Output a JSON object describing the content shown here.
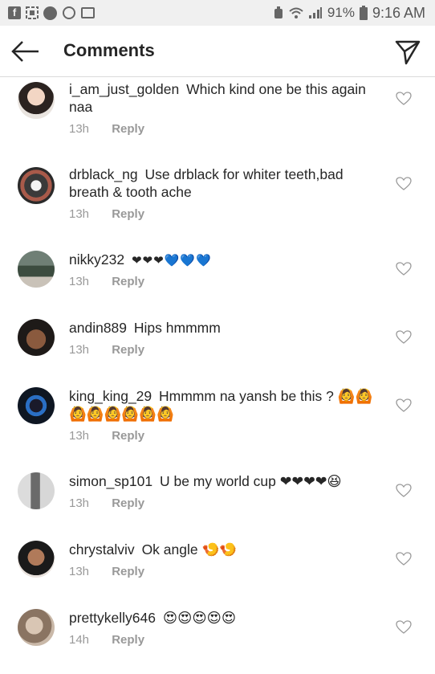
{
  "status_bar": {
    "battery": "91%",
    "time": "9:16 AM"
  },
  "header": {
    "title": "Comments"
  },
  "comments": [
    {
      "username": "i_am_just_golden",
      "text": "Which kind one be this again naa",
      "time": "13h",
      "reply": "Reply"
    },
    {
      "username": "drblack_ng",
      "text": "Use drblack for whiter teeth,bad breath & tooth ache",
      "time": "13h",
      "reply": "Reply"
    },
    {
      "username": "nikky232",
      "text": "❤❤❤💙💙💙",
      "time": "13h",
      "reply": "Reply"
    },
    {
      "username": "andin889",
      "text": "Hips hmmmm",
      "time": "13h",
      "reply": "Reply"
    },
    {
      "username": "king_king_29",
      "text": "Hmmmm na yansh be this ? 🙆🙆 🙆🙆🙆🙆🙆🙆",
      "time": "13h",
      "reply": "Reply"
    },
    {
      "username": "simon_sp101",
      "text": "U be my world cup ❤❤❤❤😆",
      "time": "13h",
      "reply": "Reply"
    },
    {
      "username": "chrystalviv",
      "text": "Ok angle 🍤🍤",
      "time": "13h",
      "reply": "Reply"
    },
    {
      "username": "prettykelly646",
      "text": "😍😍😍😍😍",
      "time": "14h",
      "reply": "Reply"
    }
  ],
  "colors": {
    "text": "#262626",
    "meta": "#999999",
    "heart_red": "#e8243c",
    "heart_blue": "#2a9df4"
  }
}
